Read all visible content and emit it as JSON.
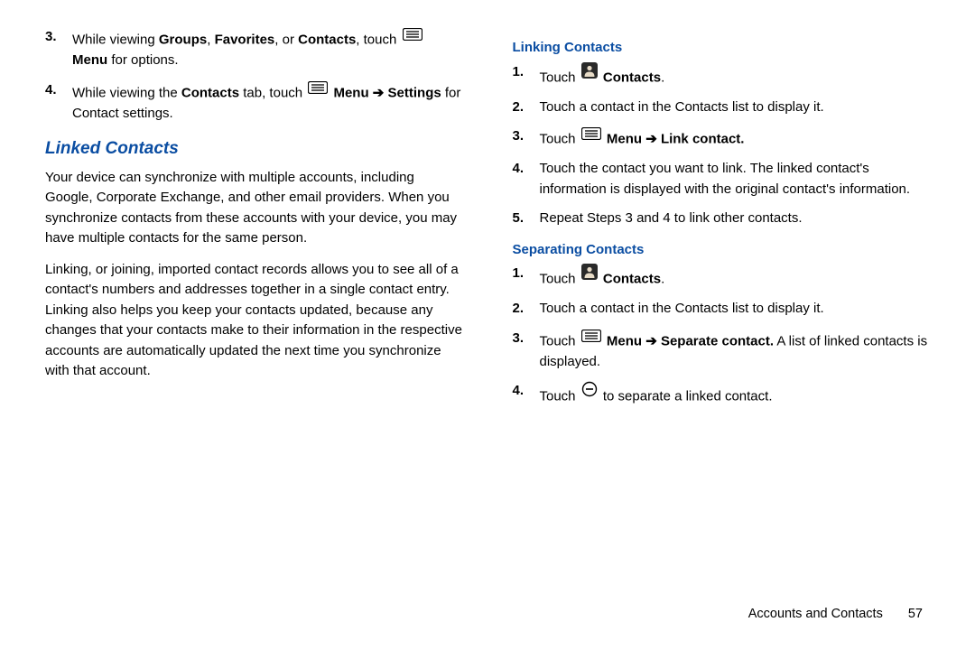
{
  "left": {
    "items": [
      {
        "num": "3.",
        "parts": [
          {
            "t": "text",
            "v": "While viewing "
          },
          {
            "t": "b",
            "v": "Groups"
          },
          {
            "t": "text",
            "v": ", "
          },
          {
            "t": "b",
            "v": "Favorites"
          },
          {
            "t": "text",
            "v": ", or "
          },
          {
            "t": "b",
            "v": "Contacts"
          },
          {
            "t": "text",
            "v": ", touch "
          },
          {
            "t": "icon",
            "v": "menu"
          },
          {
            "t": "text",
            "v": " "
          },
          {
            "t": "b",
            "v": "Menu"
          },
          {
            "t": "text",
            "v": " for options."
          }
        ]
      },
      {
        "num": "4.",
        "parts": [
          {
            "t": "text",
            "v": "While viewing the "
          },
          {
            "t": "b",
            "v": "Contacts"
          },
          {
            "t": "text",
            "v": " tab, touch "
          },
          {
            "t": "icon",
            "v": "menu"
          },
          {
            "t": "text",
            "v": " "
          },
          {
            "t": "b",
            "v": "Menu ➔ Settings"
          },
          {
            "t": "text",
            "v": " for Contact settings."
          }
        ]
      }
    ],
    "heading": "Linked Contacts",
    "para1": "Your device can synchronize with multiple accounts, including Google, Corporate Exchange, and other email providers. When you synchronize contacts from these accounts with your device, you may have multiple contacts for the same person.",
    "para2": "Linking, or joining, imported contact records allows you to see all of a contact's numbers and addresses together in a single contact entry. Linking also helps you keep your contacts updated, because any changes that your contacts make to their information in the respective accounts are automatically updated the next time you synchronize with that account."
  },
  "right": {
    "heading1": "Linking Contacts",
    "listA": [
      {
        "num": "1.",
        "parts": [
          {
            "t": "text",
            "v": "Touch "
          },
          {
            "t": "icon",
            "v": "contacts"
          },
          {
            "t": "text",
            "v": " "
          },
          {
            "t": "b",
            "v": "Contacts"
          },
          {
            "t": "text",
            "v": "."
          }
        ]
      },
      {
        "num": "2.",
        "parts": [
          {
            "t": "text",
            "v": "Touch a contact in the "
          },
          {
            "t": "sub",
            "v": "Contacts list "
          },
          {
            "t": "text",
            "v": "to display it."
          }
        ]
      },
      {
        "num": "3.",
        "parts": [
          {
            "t": "text",
            "v": "Touch "
          },
          {
            "t": "icon",
            "v": "menu"
          },
          {
            "t": "text",
            "v": " "
          },
          {
            "t": "b",
            "v": "Menu ➔ Link contact."
          }
        ]
      },
      {
        "num": "4.",
        "parts": [
          {
            "t": "text",
            "v": "Touch the contact you want to link. The linked contact's information is displayed with the original contact's information."
          }
        ]
      },
      {
        "num": "5.",
        "parts": [
          {
            "t": "text",
            "v": "Repeat Steps 3 and 4 to link other contacts."
          }
        ]
      }
    ],
    "heading2": "Separating Contacts",
    "listB": [
      {
        "num": "1.",
        "parts": [
          {
            "t": "text",
            "v": "Touch "
          },
          {
            "t": "icon",
            "v": "contacts"
          },
          {
            "t": "text",
            "v": " "
          },
          {
            "t": "b",
            "v": "Contacts"
          },
          {
            "t": "text",
            "v": "."
          }
        ]
      },
      {
        "num": "2.",
        "parts": [
          {
            "t": "text",
            "v": "Touch a contact in the "
          },
          {
            "t": "sub",
            "v": "Contacts list "
          },
          {
            "t": "text",
            "v": "to display it."
          }
        ]
      },
      {
        "num": "3.",
        "parts": [
          {
            "t": "text",
            "v": "Touch "
          },
          {
            "t": "icon",
            "v": "menu"
          },
          {
            "t": "text",
            "v": " "
          },
          {
            "t": "b",
            "v": "Menu ➔ Separate contact."
          },
          {
            "t": "text",
            "v": " A list of linked contacts is displayed."
          }
        ]
      },
      {
        "num": "4.",
        "parts": [
          {
            "t": "text",
            "v": "Touch "
          },
          {
            "t": "icon",
            "v": "minus"
          },
          {
            "t": "text",
            "v": " to separate a linked contact."
          }
        ]
      }
    ]
  },
  "footer": {
    "section": "Accounts and Contacts",
    "page": "57"
  }
}
